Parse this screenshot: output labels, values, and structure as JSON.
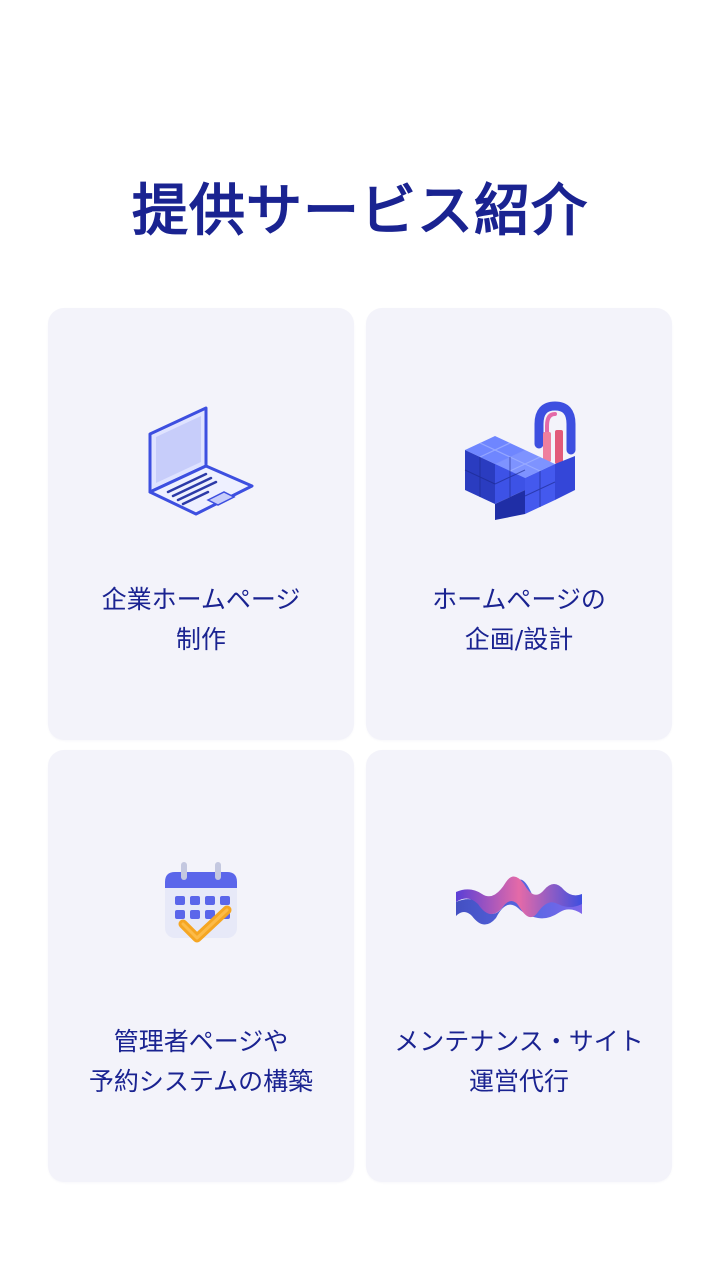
{
  "page": {
    "title": "提供サービス紹介"
  },
  "services": [
    {
      "icon": "laptop-icon",
      "line1": "企業ホームページ",
      "line2": "制作"
    },
    {
      "icon": "data-blocks-lock-icon",
      "line1": "ホームページの",
      "line2": "企画/設計"
    },
    {
      "icon": "calendar-check-icon",
      "line1": "管理者ページや",
      "line2": "予約システムの構築"
    },
    {
      "icon": "wave-graph-icon",
      "line1": "メンテナンス・サイト",
      "line2": "運営代行"
    }
  ],
  "colors": {
    "heading": "#1a2391",
    "card_background": "#f3f3fa",
    "accent_blue": "#3d4fe0",
    "accent_orange": "#f5a623",
    "accent_pink": "#e46aa8"
  }
}
